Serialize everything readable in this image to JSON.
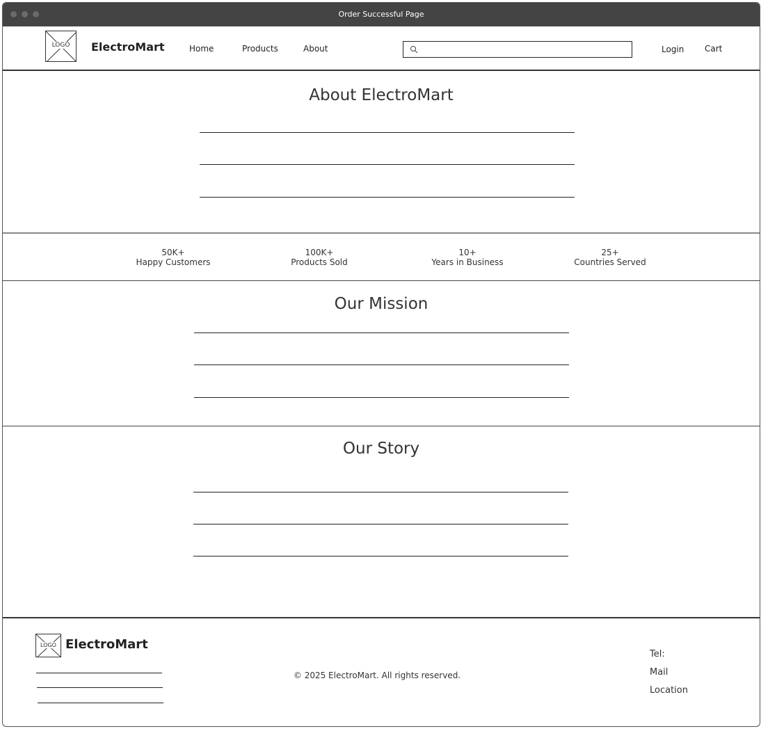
{
  "window": {
    "title": "Order Successful Page"
  },
  "nav": {
    "logo_text": "LOGO",
    "brand": "ElectroMart",
    "links": [
      "Home",
      "Products",
      "About"
    ],
    "search": {
      "value": "",
      "placeholder": ""
    },
    "login": "Login",
    "cart": "Cart"
  },
  "about": {
    "title": "About ElectroMart"
  },
  "stats": [
    {
      "value": "50K+",
      "label": "Happy Customers"
    },
    {
      "value": "100K+",
      "label": "Products Sold"
    },
    {
      "value": "10+",
      "label": "Years in Business"
    },
    {
      "value": "25+",
      "label": "Countries Served"
    }
  ],
  "mission": {
    "title": "Our Mission"
  },
  "story": {
    "title": "Our Story"
  },
  "footer": {
    "logo_text": "LOGO",
    "brand": "ElectroMart",
    "copyright": "© 2025 ElectroMart. All rights reserved.",
    "contact": [
      "Tel:",
      "Mail",
      "Location"
    ]
  }
}
